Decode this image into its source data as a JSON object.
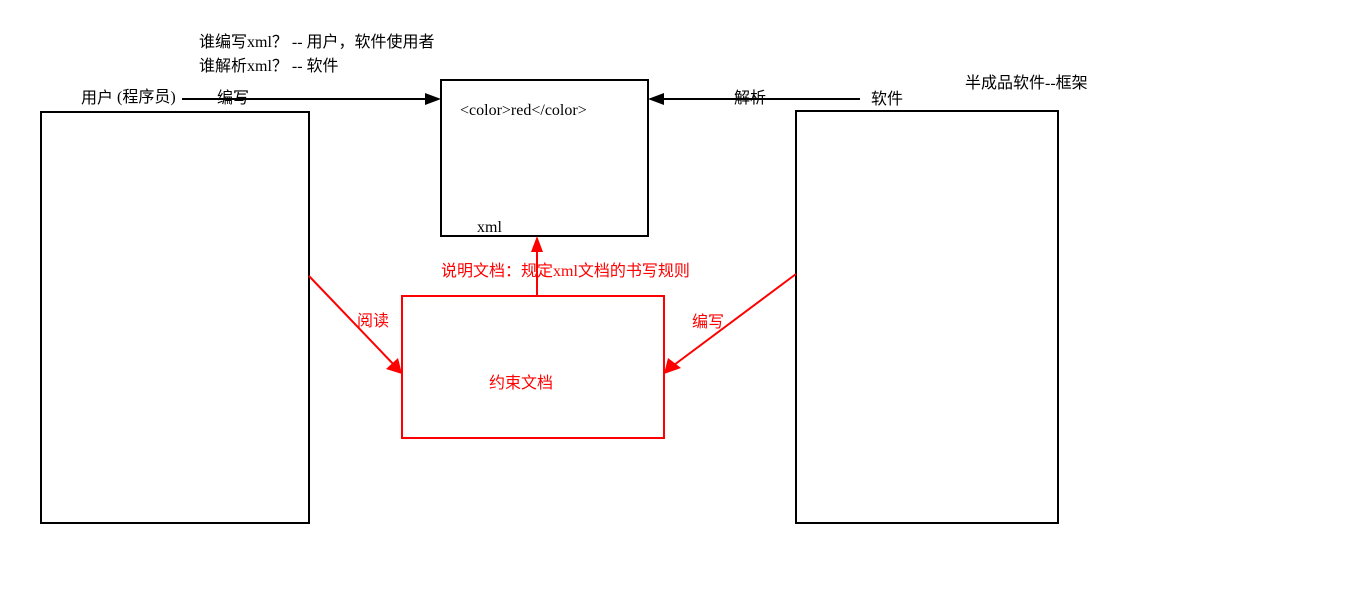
{
  "header": {
    "line1": "谁编写xml？ -- 用户，软件使用者",
    "line2": "谁解析xml？ -- 软件"
  },
  "left": {
    "user_label": "用户",
    "programmer_label": "(程序员)"
  },
  "right": {
    "software_label": "软件",
    "framework_label": "半成品软件--框架"
  },
  "center": {
    "xml_content": "<color>red</color>",
    "xml_label": "xml"
  },
  "arrows": {
    "write_label": "编写",
    "parse_label": "解析"
  },
  "red": {
    "doc_note": "说明文档：规定xml文档的书写规则",
    "constraint_doc": "约束文档",
    "read_label": "阅读",
    "write_label": "编写"
  }
}
